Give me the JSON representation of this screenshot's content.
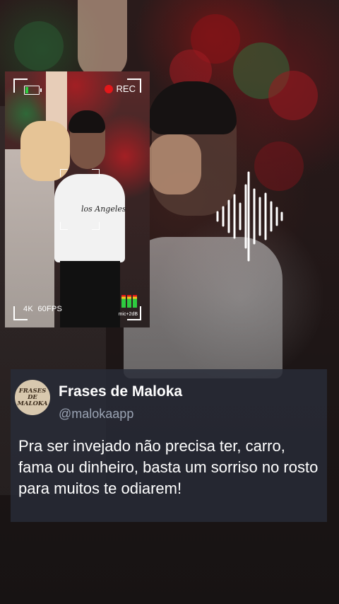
{
  "camera": {
    "rec_label": "REC",
    "quality_label": "4K  60FPS",
    "mic_label": "mic+2dB",
    "battery_level": 0.2,
    "shirt_print": "los Angeles",
    "icons": [
      "battery-icon",
      "rec-dot-icon",
      "audio-level-meter-icon"
    ],
    "colors": {
      "rec": "#e3171a",
      "battery": "#2ecc40"
    }
  },
  "waveform": {
    "icon": "audio-waveform-icon",
    "color": "#ffffff"
  },
  "tweet": {
    "avatar_text": "FRASES DE MALOKA",
    "name": "Frases de Maloka",
    "handle": "@malokaapp",
    "text": "Pra ser invejado não precisa ter, carro, fama ou dinheiro, basta um sorriso no rosto para muitos te odiarem!"
  }
}
